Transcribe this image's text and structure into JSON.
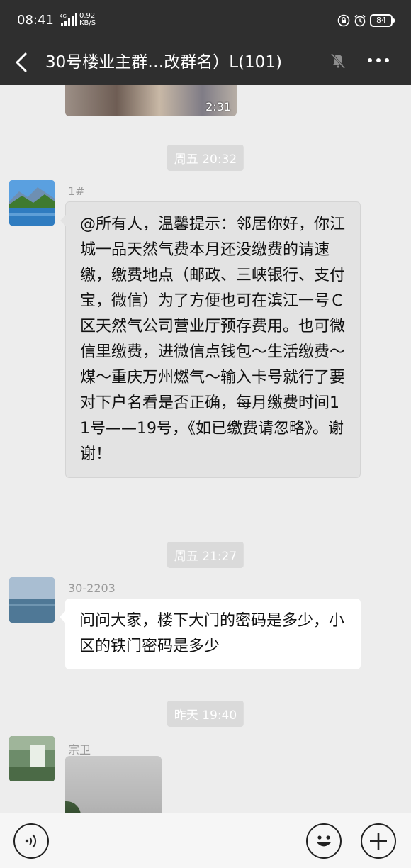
{
  "status_bar": {
    "time": "08:41",
    "net_label": "4G",
    "speed_value": "0.92",
    "speed_unit": "KB/S",
    "battery": "84"
  },
  "header": {
    "title": "30号楼业主群…改群名）L(101)",
    "icons": {
      "back": "chevron-left-icon",
      "mute": "bell-off-icon",
      "more": "more-dots-icon"
    }
  },
  "video_message": {
    "duration": "2:31"
  },
  "messages": [
    {
      "time": "周五 20:32",
      "sender": "1#",
      "text": "@所有人，温馨提示：邻居你好，你江城一品天然气费本月还没缴费的请速缴，缴费地点（邮政、三峡银行、支付宝，微信）为了方便也可在滨江一号Ｃ区天然气公司营业厅预存费用。也可微信里缴费，进微信点钱包～生活缴费～煤～重庆万州燃气～输入卡号就行了要对下户名看是否正确，每月缴费时间11号——19号，《如已缴费请忽略》。谢谢！"
    },
    {
      "time": "周五 21:27",
      "sender": "30-2203",
      "text": "问问大家，楼下大门的密码是多少，小区的铁门密码是多少"
    },
    {
      "time": "昨天 19:40",
      "sender": "宗卫",
      "text": ""
    }
  ],
  "input_bar": {
    "placeholder": "",
    "icons": {
      "voice": "voice-icon",
      "emoji": "emoji-icon",
      "plus": "plus-icon"
    }
  },
  "colors": {
    "header_bg": "#2f2f2f",
    "chat_bg": "#ededed",
    "bubble_grey": "#e3e3e3",
    "bubble_white": "#ffffff",
    "time_pill": "#dadada"
  }
}
